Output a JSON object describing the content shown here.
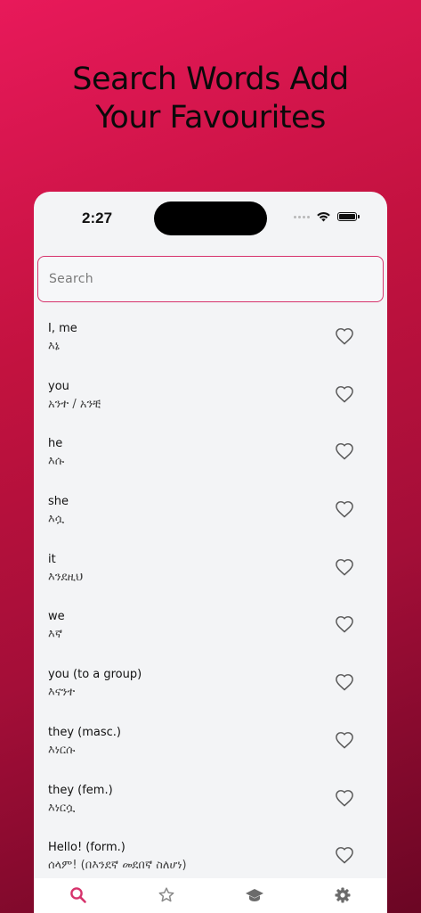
{
  "headline": {
    "line1": "Search Words Add",
    "line2": "Your Favourites"
  },
  "status_bar": {
    "time": "2:27"
  },
  "search": {
    "placeholder": "Search",
    "value": ""
  },
  "words": [
    {
      "en": "I, me",
      "am": "እኔ",
      "favourite": false
    },
    {
      "en": "you",
      "am": "አንተ / አንቺ",
      "favourite": false
    },
    {
      "en": "he",
      "am": "እሱ",
      "favourite": false
    },
    {
      "en": "she",
      "am": "እሷ",
      "favourite": false
    },
    {
      "en": "it",
      "am": "እንደዚህ",
      "favourite": false
    },
    {
      "en": "we",
      "am": "እኛ",
      "favourite": false
    },
    {
      "en": "you (to a group)",
      "am": "እናንተ",
      "favourite": false
    },
    {
      "en": "they (masc.)",
      "am": "እነርሱ",
      "favourite": false
    },
    {
      "en": "they (fem.)",
      "am": "እነርሷ",
      "favourite": false
    },
    {
      "en": "Hello! (form.)",
      "am": "ሰላም! (በእንደኛ መደበኛ ስለሆነ)",
      "favourite": false
    }
  ],
  "tabs": [
    {
      "label": "Search",
      "icon": "search-icon",
      "active": true
    },
    {
      "label": "Favourite",
      "icon": "star-icon",
      "active": false
    },
    {
      "label": "Learn",
      "icon": "graduation-cap-icon",
      "active": false
    },
    {
      "label": "Settings",
      "icon": "gear-icon",
      "active": false
    }
  ],
  "colors": {
    "accent": "#d6336c",
    "heart_outline": "#555555",
    "tab_inactive": "#9a9a9a"
  }
}
